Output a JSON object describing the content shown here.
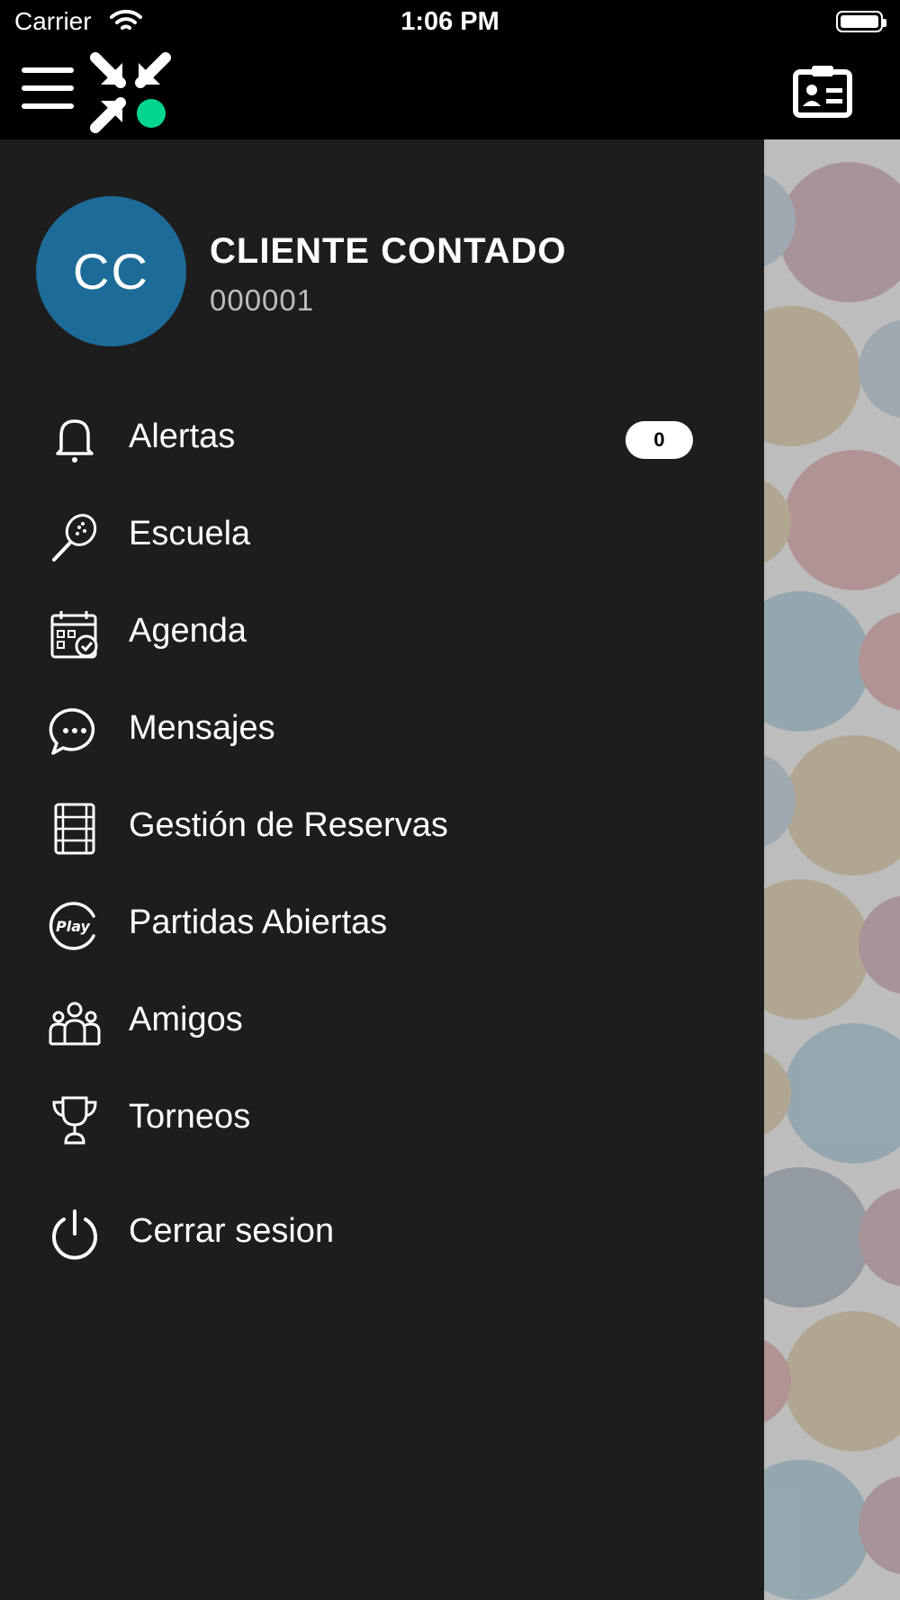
{
  "status_bar": {
    "carrier": "Carrier",
    "time": "1:06 PM"
  },
  "top_bar": {
    "menu_icon": "hamburger-icon",
    "logo_icon": "compress-arrows-logo",
    "right_icon": "id-card-icon",
    "colors": {
      "background": "#000000",
      "logo_accent": "#00d68f"
    }
  },
  "user": {
    "initials": "CC",
    "name": "CLIENTE CONTADO",
    "id": "000001",
    "avatar_color": "#1d6b99"
  },
  "menu": {
    "items": [
      {
        "label": "Alertas",
        "icon": "bell-icon",
        "badge": "0"
      },
      {
        "label": "Escuela",
        "icon": "padel-racket-icon"
      },
      {
        "label": "Agenda",
        "icon": "calendar-check-icon"
      },
      {
        "label": "Mensajes",
        "icon": "chat-bubble-icon"
      },
      {
        "label": "Gestión de Reservas",
        "icon": "court-icon"
      },
      {
        "label": "Partidas Abiertas",
        "icon": "play-badge-icon"
      },
      {
        "label": "Amigos",
        "icon": "group-icon"
      },
      {
        "label": "Torneos",
        "icon": "trophy-icon"
      },
      {
        "label": "Cerrar sesion",
        "icon": "power-icon"
      }
    ]
  },
  "colors": {
    "drawer_background": "#1d1d1d",
    "overlay_background": "#bdbdbd"
  }
}
